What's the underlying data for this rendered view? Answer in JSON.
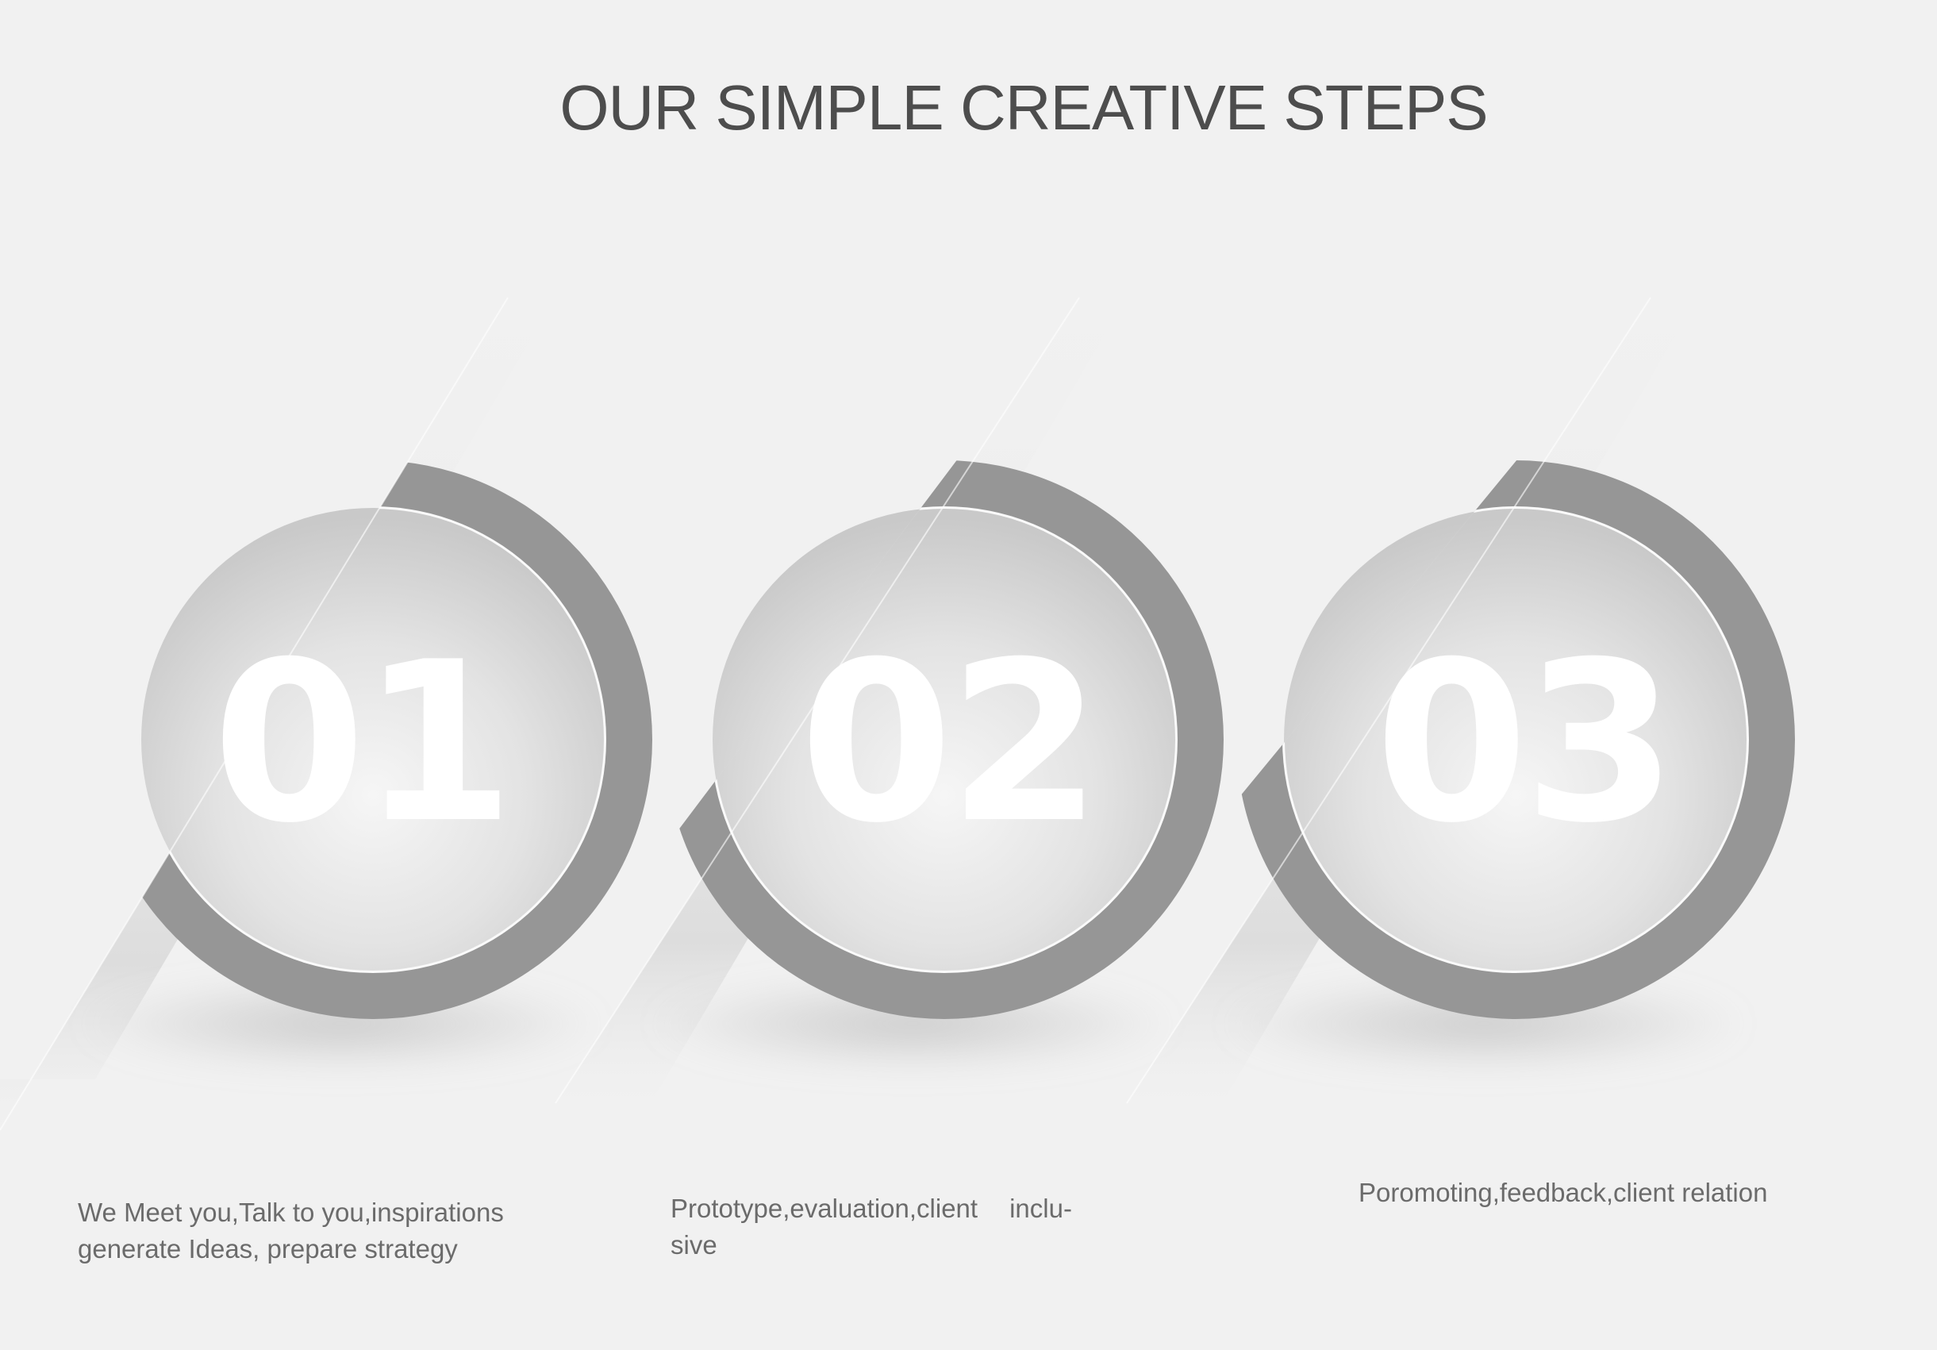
{
  "title": "OUR SIMPLE CREATIVE STEPS",
  "colors": {
    "background": "#f1f1f1",
    "ring": "#969696",
    "title": "#4d4d4d",
    "text": "#6b6b6b",
    "number": "#ffffff"
  },
  "steps": [
    {
      "number": "01",
      "description_lines": [
        "We Meet you,Talk to you,inspirations",
        "generate Ideas, prepare strategy"
      ]
    },
    {
      "number": "02",
      "description_lines": [
        "Prototype,evaluation,client",
        "inclu-",
        "sive"
      ]
    },
    {
      "number": "03",
      "description_lines": [
        "Poromoting,feedback,client relation"
      ]
    }
  ]
}
